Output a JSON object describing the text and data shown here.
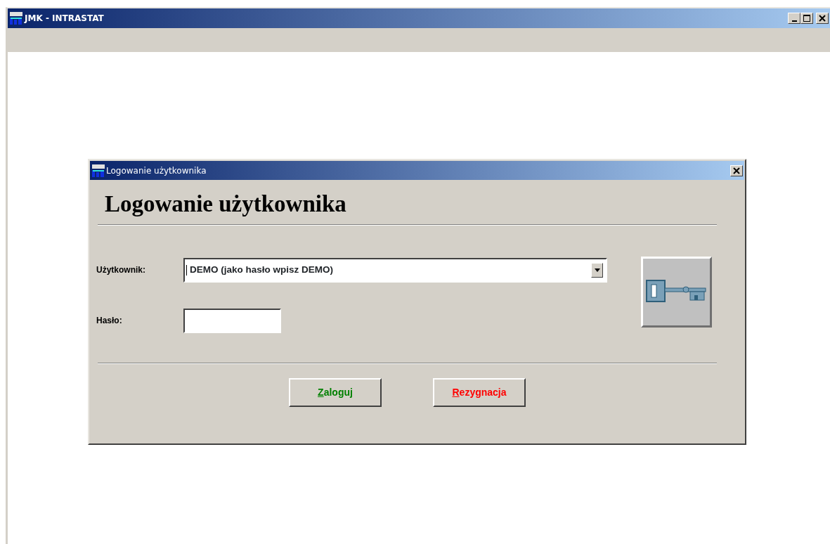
{
  "window": {
    "title": "JMK - INTRASTAT"
  },
  "dialog": {
    "title": "Logowanie użytkownika",
    "heading": "Logowanie użytkownika",
    "user": {
      "label": "Użytkownik:",
      "value": "DEMO (jako hasło wpisz DEMO)"
    },
    "password": {
      "label": "Hasło:"
    },
    "buttons": [
      {
        "label": "Zaloguj",
        "color": "#008000"
      },
      {
        "label": "Rezygnacja",
        "color": "#ff0000"
      }
    ]
  }
}
